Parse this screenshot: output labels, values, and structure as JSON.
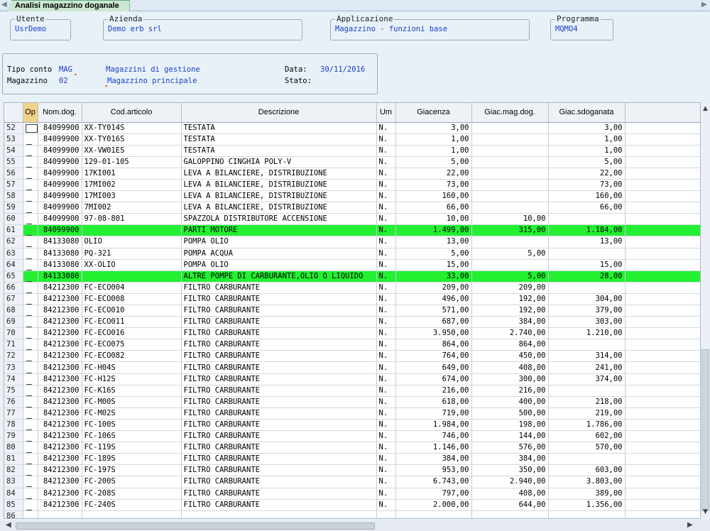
{
  "tab": {
    "title": "Analisi magazzino doganale"
  },
  "header": {
    "utente": {
      "label": "Utente",
      "value": "UsrDemo"
    },
    "azienda": {
      "label": "Azienda",
      "value": "Demo erb srl"
    },
    "applicazione": {
      "label": "Applicazione",
      "value": "Magazzino - funzioni base"
    },
    "programma": {
      "label": "Programma",
      "value": "MQMO4"
    }
  },
  "info": {
    "tipo_conto_label": "Tipo conto",
    "tipo_conto_value": "MAG",
    "tipo_conto_desc": "Magazzini di gestione",
    "magazzino_label": "Magazzino",
    "magazzino_value": "02",
    "magazzino_desc": "Magazzino principale",
    "data_label": "Data:",
    "data_value": "30/11/2016",
    "stato_label": "Stato:",
    "stato_value": ""
  },
  "grid": {
    "columns": [
      "",
      "Op",
      "Nom.dog.",
      "Cod.articolo",
      "Descrizione",
      "Um",
      "Giacenza",
      "Giac.mag.dog.",
      "Giac.sdoganata",
      ""
    ],
    "rows": [
      {
        "n": "52",
        "nom": "84099900",
        "cod": "XX-TY014S",
        "desc": "TESTATA",
        "um": "N.",
        "giac": "3,00",
        "mag": "",
        "sdog": "3,00",
        "green": false
      },
      {
        "n": "53",
        "nom": "84099900",
        "cod": "XX-TY016S",
        "desc": "TESTATA",
        "um": "N.",
        "giac": "1,00",
        "mag": "",
        "sdog": "1,00",
        "green": false
      },
      {
        "n": "54",
        "nom": "84099900",
        "cod": "XX-VW01ES",
        "desc": "TESTATA",
        "um": "N.",
        "giac": "1,00",
        "mag": "",
        "sdog": "1,00",
        "green": false
      },
      {
        "n": "55",
        "nom": "84099900",
        "cod": "129-01-105",
        "desc": "GALOPPINO CINGHIA POLY-V",
        "um": "N.",
        "giac": "5,00",
        "mag": "",
        "sdog": "5,00",
        "green": false
      },
      {
        "n": "56",
        "nom": "84099900",
        "cod": "17KI001",
        "desc": "LEVA A BILANCIERE, DISTRIBUZIONE",
        "um": "N.",
        "giac": "22,00",
        "mag": "",
        "sdog": "22,00",
        "green": false
      },
      {
        "n": "57",
        "nom": "84099900",
        "cod": "17MI002",
        "desc": "LEVA A BILANCIERE, DISTRIBUZIONE",
        "um": "N.",
        "giac": "73,00",
        "mag": "",
        "sdog": "73,00",
        "green": false
      },
      {
        "n": "58",
        "nom": "84099900",
        "cod": "17MI003",
        "desc": "LEVA A BILANCIERE, DISTRIBUZIONE",
        "um": "N.",
        "giac": "160,00",
        "mag": "",
        "sdog": "160,00",
        "green": false
      },
      {
        "n": "59",
        "nom": "84099900",
        "cod": "7MI002",
        "desc": "LEVA A BILANCIERE, DISTRIBUZIONE",
        "um": "N.",
        "giac": "66,00",
        "mag": "",
        "sdog": "66,00",
        "green": false
      },
      {
        "n": "60",
        "nom": "84099900",
        "cod": "97-08-801",
        "desc": "SPAZZOLA DISTRIBUTORE ACCENSIONE",
        "um": "N.",
        "giac": "10,00",
        "mag": "10,00",
        "sdog": "",
        "green": false
      },
      {
        "n": "61",
        "nom": "84099900",
        "cod": "",
        "desc": "PARTI MOTORE",
        "um": "N.",
        "giac": "1.499,00",
        "mag": "315,00",
        "sdog": "1.184,00",
        "green": true
      },
      {
        "n": "62",
        "nom": "84133080",
        "cod": "OLIO",
        "desc": "POMPA OLIO",
        "um": "N.",
        "giac": "13,00",
        "mag": "",
        "sdog": "13,00",
        "green": false
      },
      {
        "n": "63",
        "nom": "84133080",
        "cod": "PQ-321",
        "desc": "POMPA ACQUA",
        "um": "N.",
        "giac": "5,00",
        "mag": "5,00",
        "sdog": "",
        "green": false
      },
      {
        "n": "64",
        "nom": "84133080",
        "cod": "XX-OLIO",
        "desc": "POMPA OLIO",
        "um": "N.",
        "giac": "15,00",
        "mag": "",
        "sdog": "15,00",
        "green": false
      },
      {
        "n": "65",
        "nom": "84133080",
        "cod": "",
        "desc": "ALTRE POMPE DI CARBURANTE,OLIO O LIQUIDO",
        "um": "N.",
        "giac": "33,00",
        "mag": "5,00",
        "sdog": "28,00",
        "green": true
      },
      {
        "n": "66",
        "nom": "84212300",
        "cod": "FC-ECO004",
        "desc": "FILTRO CARBURANTE",
        "um": "N.",
        "giac": "209,00",
        "mag": "209,00",
        "sdog": "",
        "green": false
      },
      {
        "n": "67",
        "nom": "84212300",
        "cod": "FC-ECO008",
        "desc": "FILTRO CARBURANTE",
        "um": "N.",
        "giac": "496,00",
        "mag": "192,00",
        "sdog": "304,00",
        "green": false
      },
      {
        "n": "68",
        "nom": "84212300",
        "cod": "FC-ECO010",
        "desc": "FILTRO CARBURANTE",
        "um": "N.",
        "giac": "571,00",
        "mag": "192,00",
        "sdog": "379,00",
        "green": false
      },
      {
        "n": "69",
        "nom": "84212300",
        "cod": "FC-ECO011",
        "desc": "FILTRO CARBURANTE",
        "um": "N.",
        "giac": "687,00",
        "mag": "384,00",
        "sdog": "303,00",
        "green": false
      },
      {
        "n": "70",
        "nom": "84212300",
        "cod": "FC-ECO016",
        "desc": "FILTRO CARBURANTE",
        "um": "N.",
        "giac": "3.950,00",
        "mag": "2.740,00",
        "sdog": "1.210,00",
        "green": false
      },
      {
        "n": "71",
        "nom": "84212300",
        "cod": "FC-ECO075",
        "desc": "FILTRO CARBURANTE",
        "um": "N.",
        "giac": "864,00",
        "mag": "864,00",
        "sdog": "",
        "green": false
      },
      {
        "n": "72",
        "nom": "84212300",
        "cod": "FC-ECO082",
        "desc": "FILTRO CARBURANTE",
        "um": "N.",
        "giac": "764,00",
        "mag": "450,00",
        "sdog": "314,00",
        "green": false
      },
      {
        "n": "73",
        "nom": "84212300",
        "cod": "FC-H04S",
        "desc": "FILTRO CARBURANTE",
        "um": "N.",
        "giac": "649,00",
        "mag": "408,00",
        "sdog": "241,00",
        "green": false
      },
      {
        "n": "74",
        "nom": "84212300",
        "cod": "FC-H12S",
        "desc": "FILTRO CARBURANTE",
        "um": "N.",
        "giac": "674,00",
        "mag": "300,00",
        "sdog": "374,00",
        "green": false
      },
      {
        "n": "75",
        "nom": "84212300",
        "cod": "FC-K16S",
        "desc": "FILTRO CARBURANTE",
        "um": "N.",
        "giac": "216,00",
        "mag": "216,00",
        "sdog": "",
        "green": false
      },
      {
        "n": "76",
        "nom": "84212300",
        "cod": "FC-M00S",
        "desc": "FILTRO CARBURANTE",
        "um": "N.",
        "giac": "618,00",
        "mag": "400,00",
        "sdog": "218,00",
        "green": false
      },
      {
        "n": "77",
        "nom": "84212300",
        "cod": "FC-M02S",
        "desc": "FILTRO CARBURANTE",
        "um": "N.",
        "giac": "719,00",
        "mag": "500,00",
        "sdog": "219,00",
        "green": false
      },
      {
        "n": "78",
        "nom": "84212300",
        "cod": "FC-100S",
        "desc": "FILTRO CARBURANTE",
        "um": "N.",
        "giac": "1.984,00",
        "mag": "198,00",
        "sdog": "1.786,00",
        "green": false
      },
      {
        "n": "79",
        "nom": "84212300",
        "cod": "FC-106S",
        "desc": "FILTRO CARBURANTE",
        "um": "N.",
        "giac": "746,00",
        "mag": "144,00",
        "sdog": "602,00",
        "green": false
      },
      {
        "n": "80",
        "nom": "84212300",
        "cod": "FC-119S",
        "desc": "FILTRO CARBURANTE",
        "um": "N.",
        "giac": "1.146,00",
        "mag": "576,00",
        "sdog": "570,00",
        "green": false
      },
      {
        "n": "81",
        "nom": "84212300",
        "cod": "FC-189S",
        "desc": "FILTRO CARBURANTE",
        "um": "N.",
        "giac": "384,00",
        "mag": "384,00",
        "sdog": "",
        "green": false
      },
      {
        "n": "82",
        "nom": "84212300",
        "cod": "FC-197S",
        "desc": "FILTRO CARBURANTE",
        "um": "N.",
        "giac": "953,00",
        "mag": "350,00",
        "sdog": "603,00",
        "green": false
      },
      {
        "n": "83",
        "nom": "84212300",
        "cod": "FC-200S",
        "desc": "FILTRO CARBURANTE",
        "um": "N.",
        "giac": "6.743,00",
        "mag": "2.940,00",
        "sdog": "3.803,00",
        "green": false
      },
      {
        "n": "84",
        "nom": "84212300",
        "cod": "FC-208S",
        "desc": "FILTRO CARBURANTE",
        "um": "N.",
        "giac": "797,00",
        "mag": "408,00",
        "sdog": "389,00",
        "green": false
      },
      {
        "n": "85",
        "nom": "84212300",
        "cod": "FC-240S",
        "desc": "FILTRO CARBURANTE",
        "um": "N.",
        "giac": "2.000,00",
        "mag": "644,00",
        "sdog": "1.356,00",
        "green": false
      },
      {
        "n": "86",
        "nom": "",
        "cod": "",
        "desc": "",
        "um": "",
        "giac": "",
        "mag": "",
        "sdog": "",
        "green": false
      }
    ]
  },
  "colors": {
    "highlight_row": "#22f030",
    "value_text": "#1a3ec8",
    "tab_bg": "#c9e7d3"
  },
  "icons": {
    "tab_left": "chevron-left-icon",
    "tab_right": "chevron-right-icon",
    "scroll_up": "chevron-up-icon",
    "scroll_down": "chevron-down-icon"
  }
}
